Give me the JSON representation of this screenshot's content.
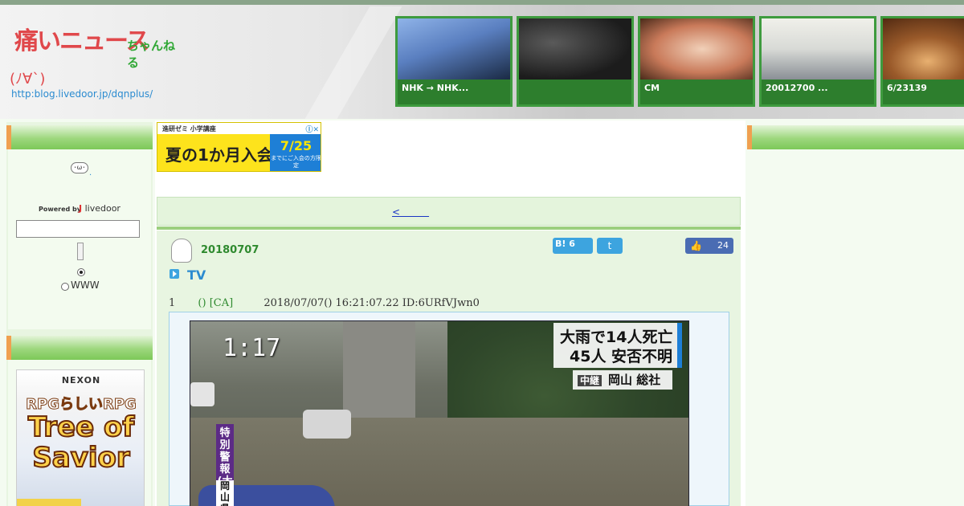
{
  "header": {
    "logo": {
      "title": "痛いニュース",
      "chan": "ちゃんねる",
      "face": "(ﾉ∀`)",
      "url": "http:blog.livedoor.jp/dqnplus/"
    },
    "thumbs": [
      {
        "caption": "NHK → NHK...",
        "colors": [
          "#5a7fc0",
          "#1a2a44"
        ]
      },
      {
        "caption": "",
        "colors": [
          "#1c1c1c",
          "#5a5a5a"
        ]
      },
      {
        "caption": "CM",
        "colors": [
          "#c97a5a",
          "#f1d0b8"
        ]
      },
      {
        "caption": "20012700 ...",
        "colors": [
          "#e8e8e2",
          "#9aa0a6"
        ]
      },
      {
        "caption": "6/23139",
        "colors": [
          "#6a3a1a",
          "#c9843c"
        ]
      }
    ]
  },
  "left": {
    "face_label": "･ω･",
    "face_dot": ".",
    "powered_by": "Powered by",
    "livedoor_brand": "livedoor",
    "search_placeholder": "",
    "radio_www": "WWW",
    "ad": {
      "brand": "NEXON",
      "line1": "RPGらしいRPG",
      "line2": "Tree of Savior"
    }
  },
  "center": {
    "ad_top": {
      "label": "進研ゼミ 小学講座",
      "close": "Ⓘ✕",
      "main": "夏の1か月入会",
      "date": "7/25",
      "sub": "までにご入会の方限定"
    },
    "nav_link": "<　　　",
    "article": {
      "date": "20180707",
      "hatena_count": "B! 6",
      "twitter": "t",
      "fb_count": "24",
      "title": "TV",
      "res": {
        "num": "1",
        "name": "() [CA]",
        "meta": "2018/07/07() 16:21:07.22 ID:6URfVJwn0"
      },
      "tv": {
        "clock": "1:17",
        "headline1": "大雨で14人死亡",
        "headline2": "45人 安否不明",
        "location_tag": "中継",
        "location": "岡山 総社",
        "warning": "特別警報(大雨)",
        "pref": "岡山県"
      }
    }
  }
}
